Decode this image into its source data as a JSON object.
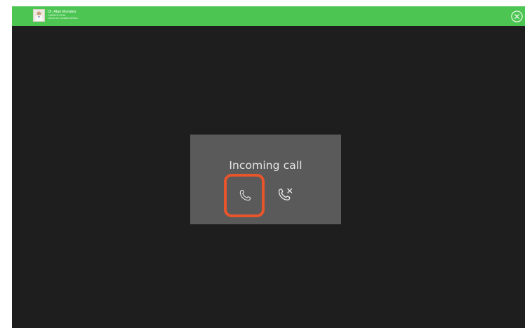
{
  "header": {
    "doctor_name": "Dr. Alan Morales",
    "doctor_specialty": "CARDIOLOGIA",
    "doctor_clinic": "Clinica de Cuidado Medico",
    "close_icon": "close-circle-icon",
    "bar_color": "#4cc552"
  },
  "call": {
    "title": "Incoming call",
    "accept_icon": "phone-icon",
    "decline_icon": "phone-decline-icon",
    "highlight_color": "#e8552b"
  },
  "colors": {
    "background": "#1e1e1e",
    "dialog": "#5a5a5a"
  }
}
